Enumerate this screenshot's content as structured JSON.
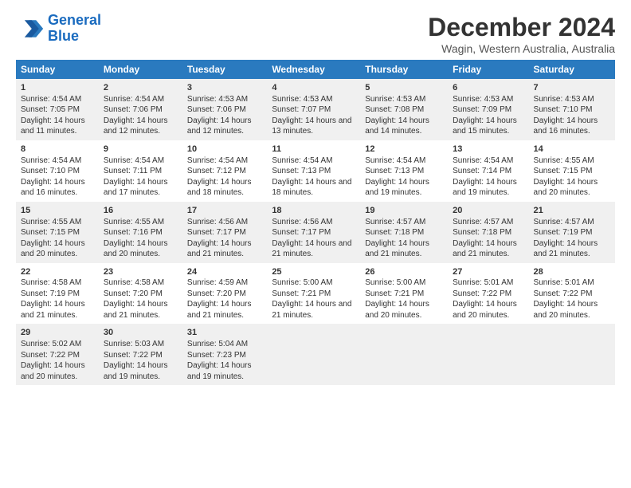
{
  "logo": {
    "line1": "General",
    "line2": "Blue"
  },
  "title": "December 2024",
  "subtitle": "Wagin, Western Australia, Australia",
  "weekdays": [
    "Sunday",
    "Monday",
    "Tuesday",
    "Wednesday",
    "Thursday",
    "Friday",
    "Saturday"
  ],
  "weeks": [
    [
      {
        "day": "1",
        "rise": "4:54 AM",
        "set": "7:05 PM",
        "daylight": "14 hours and 11 minutes."
      },
      {
        "day": "2",
        "rise": "4:54 AM",
        "set": "7:06 PM",
        "daylight": "14 hours and 12 minutes."
      },
      {
        "day": "3",
        "rise": "4:53 AM",
        "set": "7:06 PM",
        "daylight": "14 hours and 12 minutes."
      },
      {
        "day": "4",
        "rise": "4:53 AM",
        "set": "7:07 PM",
        "daylight": "14 hours and 13 minutes."
      },
      {
        "day": "5",
        "rise": "4:53 AM",
        "set": "7:08 PM",
        "daylight": "14 hours and 14 minutes."
      },
      {
        "day": "6",
        "rise": "4:53 AM",
        "set": "7:09 PM",
        "daylight": "14 hours and 15 minutes."
      },
      {
        "day": "7",
        "rise": "4:53 AM",
        "set": "7:10 PM",
        "daylight": "14 hours and 16 minutes."
      }
    ],
    [
      {
        "day": "8",
        "rise": "4:54 AM",
        "set": "7:10 PM",
        "daylight": "14 hours and 16 minutes."
      },
      {
        "day": "9",
        "rise": "4:54 AM",
        "set": "7:11 PM",
        "daylight": "14 hours and 17 minutes."
      },
      {
        "day": "10",
        "rise": "4:54 AM",
        "set": "7:12 PM",
        "daylight": "14 hours and 18 minutes."
      },
      {
        "day": "11",
        "rise": "4:54 AM",
        "set": "7:13 PM",
        "daylight": "14 hours and 18 minutes."
      },
      {
        "day": "12",
        "rise": "4:54 AM",
        "set": "7:13 PM",
        "daylight": "14 hours and 19 minutes."
      },
      {
        "day": "13",
        "rise": "4:54 AM",
        "set": "7:14 PM",
        "daylight": "14 hours and 19 minutes."
      },
      {
        "day": "14",
        "rise": "4:55 AM",
        "set": "7:15 PM",
        "daylight": "14 hours and 20 minutes."
      }
    ],
    [
      {
        "day": "15",
        "rise": "4:55 AM",
        "set": "7:15 PM",
        "daylight": "14 hours and 20 minutes."
      },
      {
        "day": "16",
        "rise": "4:55 AM",
        "set": "7:16 PM",
        "daylight": "14 hours and 20 minutes."
      },
      {
        "day": "17",
        "rise": "4:56 AM",
        "set": "7:17 PM",
        "daylight": "14 hours and 21 minutes."
      },
      {
        "day": "18",
        "rise": "4:56 AM",
        "set": "7:17 PM",
        "daylight": "14 hours and 21 minutes."
      },
      {
        "day": "19",
        "rise": "4:57 AM",
        "set": "7:18 PM",
        "daylight": "14 hours and 21 minutes."
      },
      {
        "day": "20",
        "rise": "4:57 AM",
        "set": "7:18 PM",
        "daylight": "14 hours and 21 minutes."
      },
      {
        "day": "21",
        "rise": "4:57 AM",
        "set": "7:19 PM",
        "daylight": "14 hours and 21 minutes."
      }
    ],
    [
      {
        "day": "22",
        "rise": "4:58 AM",
        "set": "7:19 PM",
        "daylight": "14 hours and 21 minutes."
      },
      {
        "day": "23",
        "rise": "4:58 AM",
        "set": "7:20 PM",
        "daylight": "14 hours and 21 minutes."
      },
      {
        "day": "24",
        "rise": "4:59 AM",
        "set": "7:20 PM",
        "daylight": "14 hours and 21 minutes."
      },
      {
        "day": "25",
        "rise": "5:00 AM",
        "set": "7:21 PM",
        "daylight": "14 hours and 21 minutes."
      },
      {
        "day": "26",
        "rise": "5:00 AM",
        "set": "7:21 PM",
        "daylight": "14 hours and 20 minutes."
      },
      {
        "day": "27",
        "rise": "5:01 AM",
        "set": "7:22 PM",
        "daylight": "14 hours and 20 minutes."
      },
      {
        "day": "28",
        "rise": "5:01 AM",
        "set": "7:22 PM",
        "daylight": "14 hours and 20 minutes."
      }
    ],
    [
      {
        "day": "29",
        "rise": "5:02 AM",
        "set": "7:22 PM",
        "daylight": "14 hours and 20 minutes."
      },
      {
        "day": "30",
        "rise": "5:03 AM",
        "set": "7:22 PM",
        "daylight": "14 hours and 19 minutes."
      },
      {
        "day": "31",
        "rise": "5:04 AM",
        "set": "7:23 PM",
        "daylight": "14 hours and 19 minutes."
      },
      null,
      null,
      null,
      null
    ]
  ]
}
